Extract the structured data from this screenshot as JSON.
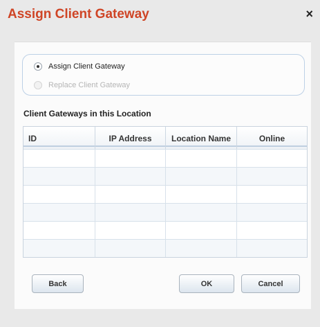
{
  "dialog": {
    "title": "Assign Client Gateway",
    "close_label": "×"
  },
  "mode_options": {
    "assign_label": "Assign Client Gateway",
    "replace_label": "Replace Client Gateway"
  },
  "gateways_section": {
    "label": "Client Gateways in this Location",
    "columns": [
      "ID",
      "IP Address",
      "Location Name",
      "Online"
    ],
    "rows": []
  },
  "buttons": {
    "back": "Back",
    "ok": "OK",
    "cancel": "Cancel"
  }
}
